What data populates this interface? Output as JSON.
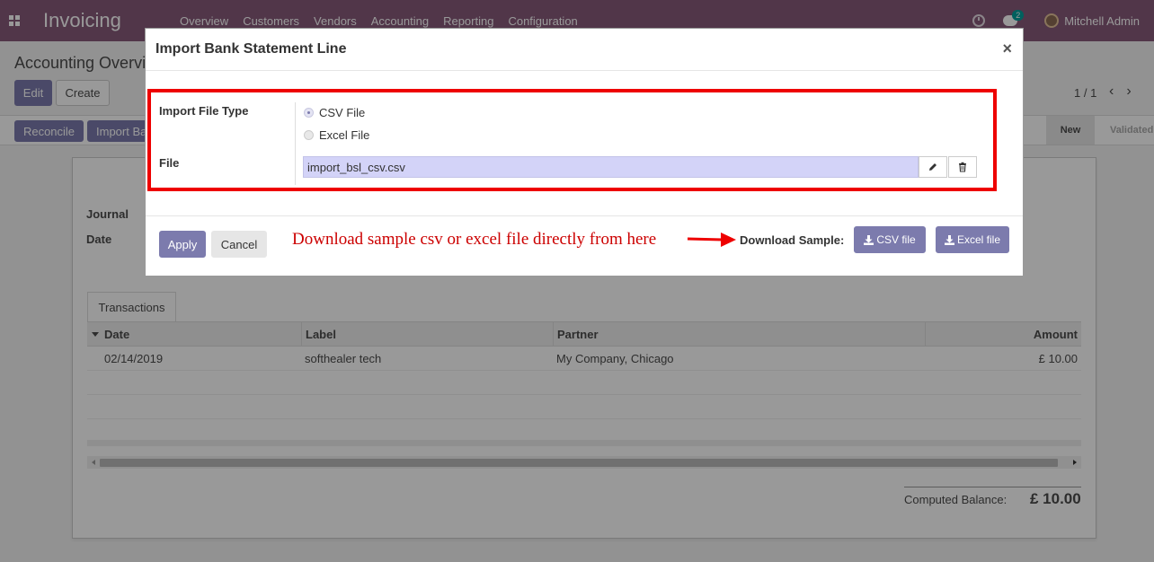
{
  "navbar": {
    "brand": "Invoicing",
    "menu": [
      "Overview",
      "Customers",
      "Vendors",
      "Accounting",
      "Reporting",
      "Configuration"
    ],
    "chat_count": "2",
    "user_name": "Mitchell Admin"
  },
  "page": {
    "breadcrumb": "Accounting Overvi",
    "edit_label": "Edit",
    "create_label": "Create",
    "pager": "1 / 1",
    "reconcile_label": "Reconcile",
    "import_label": "Import Ba",
    "stages": [
      "New",
      "Validated"
    ],
    "form_labels": {
      "journal": "Journal",
      "date": "Date"
    },
    "tab": "Transactions",
    "table": {
      "headers": [
        "Date",
        "Label",
        "Partner",
        "Amount"
      ],
      "rows": [
        {
          "date": "02/14/2019",
          "label": "softhealer tech",
          "partner": "My Company, Chicago",
          "amount": "£ 10.00"
        }
      ]
    },
    "balance_label": "Computed Balance:",
    "balance_value": "£ 10.00"
  },
  "modal": {
    "title": "Import Bank Statement Line",
    "close": "×",
    "file_type_label": "Import File Type",
    "file_type_options": [
      "CSV File",
      "Excel File"
    ],
    "file_type_selected": "CSV File",
    "file_label": "File",
    "file_value": "import_bsl_csv.csv",
    "apply_label": "Apply",
    "cancel_label": "Cancel",
    "annotation": "Download sample csv or excel file directly from here",
    "download_label": "Download Sample:",
    "csv_btn": "CSV file",
    "excel_btn": "Excel file"
  },
  "colors": {
    "brand": "#875a7b",
    "primary": "#7c7bad",
    "highlight": "#ee0000",
    "annotation": "#cc0000"
  }
}
